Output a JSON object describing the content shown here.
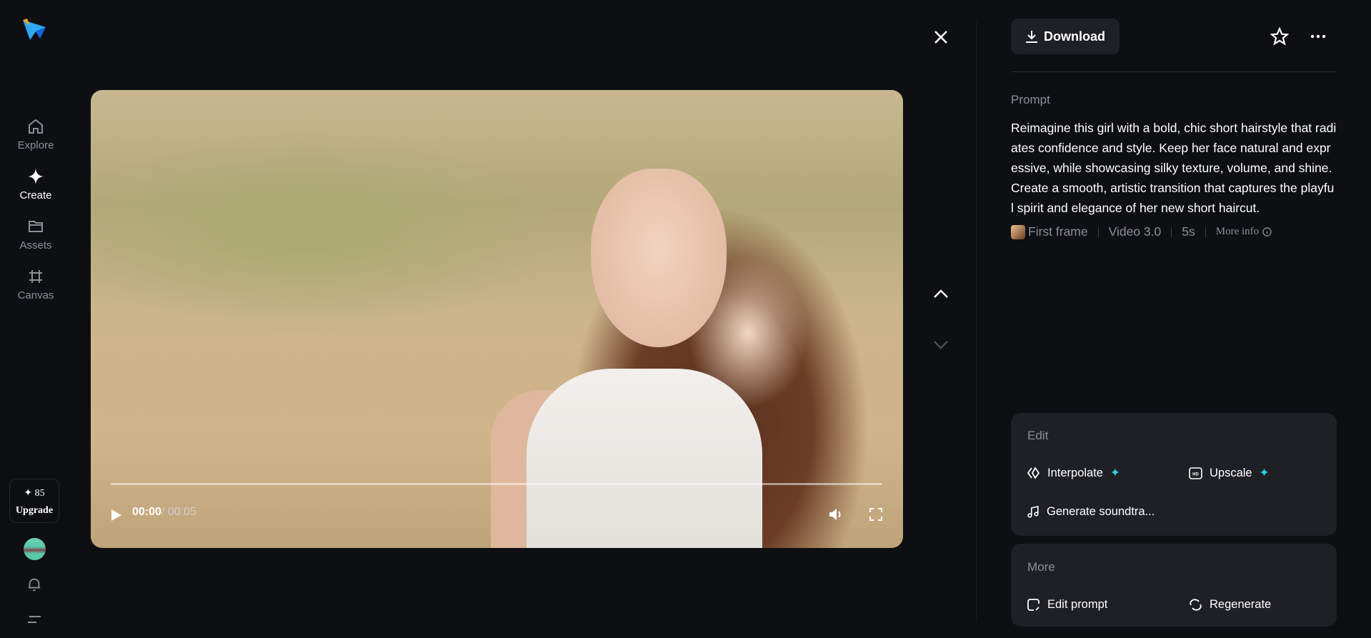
{
  "sidebar": {
    "items": [
      {
        "label": "Explore",
        "icon": "home-icon"
      },
      {
        "label": "Create",
        "icon": "sparkle-icon"
      },
      {
        "label": "Assets",
        "icon": "folder-icon"
      },
      {
        "label": "Canvas",
        "icon": "frame-icon"
      }
    ],
    "credits": "✦ 85",
    "upgrade": "Upgrade"
  },
  "player": {
    "current_time": "00:00",
    "duration": "/ 00:05",
    "progress": 0
  },
  "panel": {
    "download": "Download",
    "prompt_label": "Prompt",
    "prompt": "Reimagine this girl with a bold, chic short hairstyle that radiates confidence and style. Keep her face natural and expressive, while showcasing silky texture, volume, and shine. Create a smooth, artistic transition that captures the playful spirit and elegance of her new short haircut.",
    "meta": {
      "first_frame": "First frame",
      "model": "Video 3.0",
      "duration": "5s",
      "more_info": "More info"
    },
    "edit": {
      "label": "Edit",
      "interpolate": "Interpolate",
      "upscale": "Upscale",
      "soundtrack": "Generate soundtra..."
    },
    "more": {
      "label": "More",
      "edit_prompt": "Edit prompt",
      "regenerate": "Regenerate"
    }
  },
  "colors": {
    "accent": "#27d9f0",
    "bg": "#0e0f12",
    "card": "#1f2026"
  }
}
